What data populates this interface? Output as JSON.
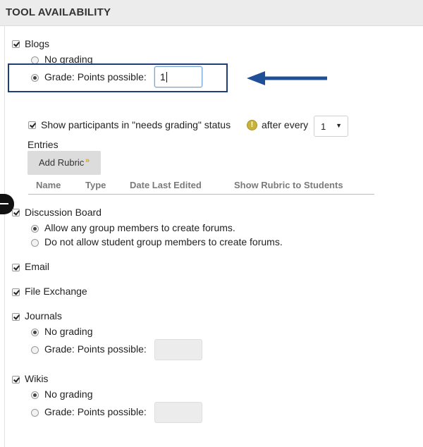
{
  "header": {
    "title": "TOOL AVAILABILITY"
  },
  "blogs": {
    "label": "Blogs",
    "no_grading": "No grading",
    "grade_points": "Grade: Points possible:",
    "points_value": "1"
  },
  "needs_grading": {
    "label": "Show participants in \"needs grading\" status",
    "after_every": "after every",
    "selected": "1",
    "entries": "Entries"
  },
  "rubric": {
    "add_button": "Add Rubric",
    "columns": [
      "Name",
      "Type",
      "Date Last Edited",
      "Show Rubric to Students"
    ]
  },
  "discussion": {
    "label": "Discussion Board",
    "allow": "Allow any group members to create forums.",
    "disallow": "Do not allow student group members to create forums."
  },
  "email": {
    "label": "Email"
  },
  "file_exchange": {
    "label": "File Exchange"
  },
  "journals": {
    "label": "Journals",
    "no_grading": "No grading",
    "grade_points": "Grade: Points possible:"
  },
  "wikis": {
    "label": "Wikis",
    "no_grading": "No grading",
    "grade_points": "Grade: Points possible:"
  },
  "colors": {
    "annotation": "#1f4f96",
    "header_bg": "#ececec"
  },
  "icons": [
    "checkbox-icon",
    "radio-icon",
    "warning-icon",
    "arrow-annotation-icon",
    "dropdown-caret-icon",
    "chevron-down-icon"
  ]
}
